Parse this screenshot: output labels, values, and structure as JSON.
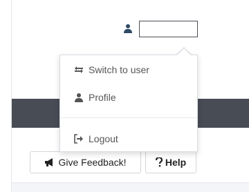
{
  "header": {
    "user_field_value": ""
  },
  "user_menu": {
    "items": [
      {
        "label": "Switch to user",
        "icon": "switch-user-icon"
      },
      {
        "label": "Profile",
        "icon": "user-icon"
      },
      {
        "label": "Logout",
        "icon": "logout-icon"
      }
    ]
  },
  "actions": {
    "feedback_label": "Give Feedback!",
    "feedback_icon": "megaphone-icon",
    "help_label": "Help",
    "help_icon": "question-icon"
  },
  "colors": {
    "dark_band": "#484c55",
    "icon": "#555555"
  }
}
